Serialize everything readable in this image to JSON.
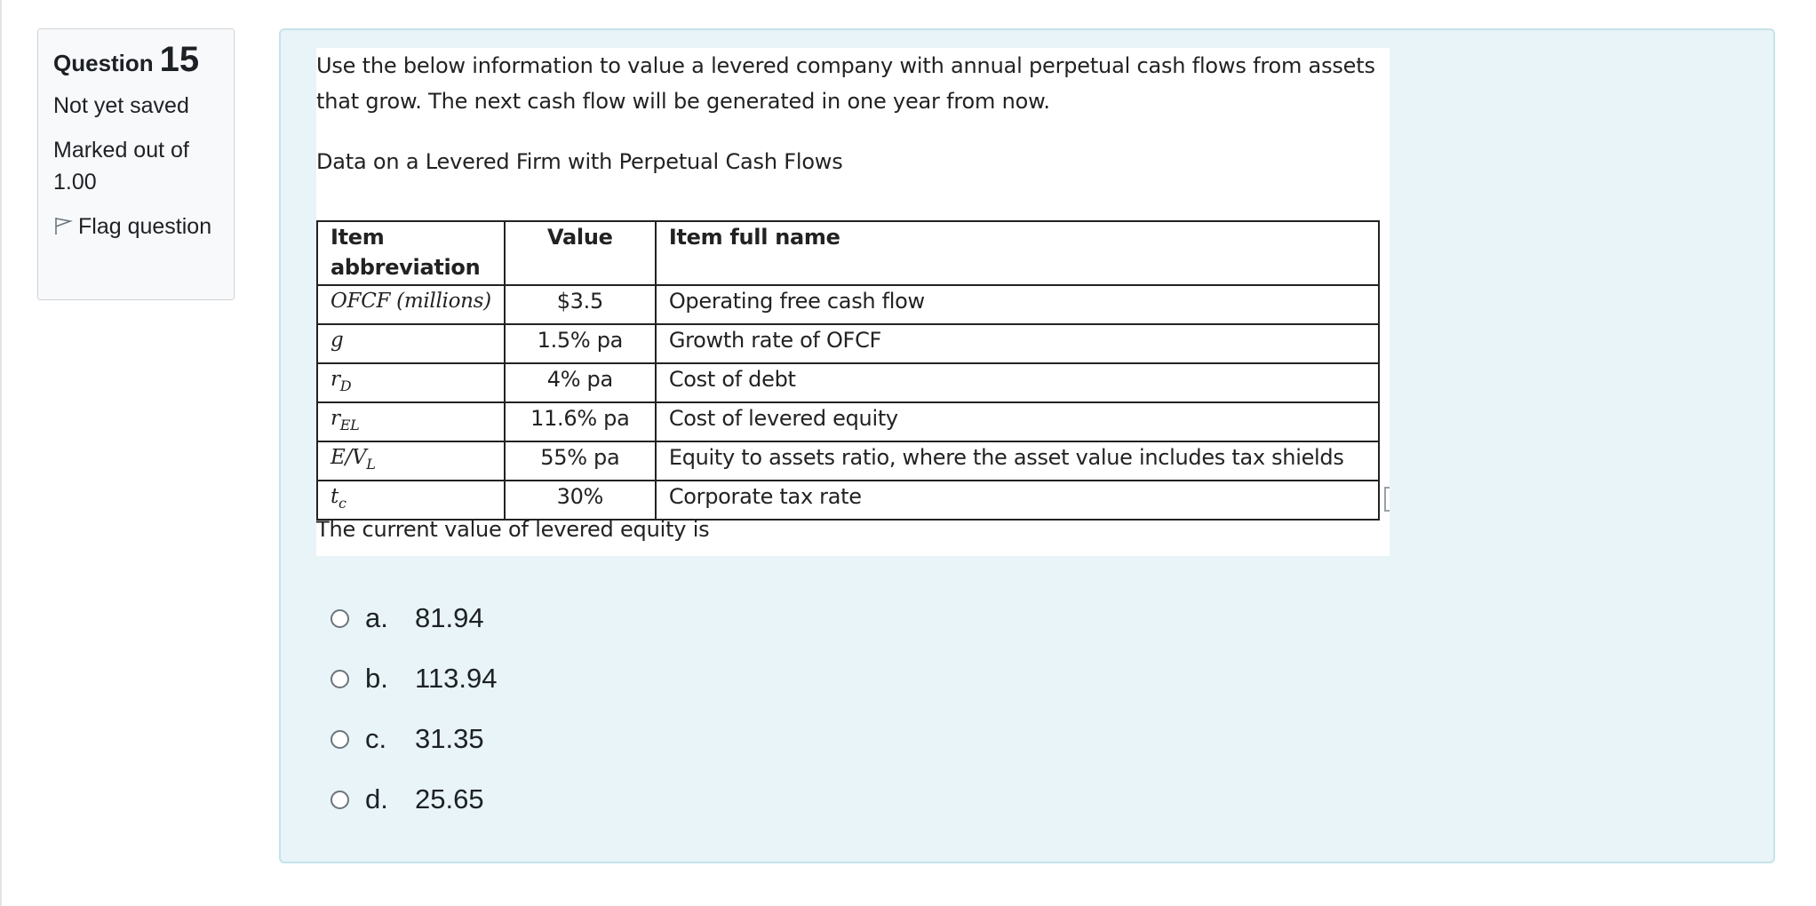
{
  "question_info": {
    "label": "Question",
    "number": "15",
    "status": "Not yet saved",
    "marks": "Marked out of 1.00",
    "flag_label": "Flag question"
  },
  "question": {
    "intro": "Use the below information to value a levered company with annual perpetual cash flows from assets that grow. The next cash flow will be generated in one year from now.",
    "caption": "Data on a Levered Firm with Perpetual Cash Flows",
    "table": {
      "headers": [
        "Item abbreviation",
        "Value",
        "Item full name"
      ],
      "rows": [
        {
          "abbr": "OFCF (millions)",
          "abbr_sub": "",
          "value": "$3.5",
          "name": "Operating free cash flow"
        },
        {
          "abbr": "g",
          "abbr_sub": "",
          "value": "1.5% pa",
          "name": "Growth rate of OFCF"
        },
        {
          "abbr": "r",
          "abbr_sub": "D",
          "value": "4% pa",
          "name": "Cost of debt"
        },
        {
          "abbr": "r",
          "abbr_sub": "EL",
          "value": "11.6% pa",
          "name": "Cost of levered equity"
        },
        {
          "abbr": "E/V",
          "abbr_sub": "L",
          "value": "55% pa",
          "name": "Equity to assets ratio, where the asset value includes tax shields"
        },
        {
          "abbr": "t",
          "abbr_sub": "c",
          "value": "30%",
          "name": "Corporate tax rate"
        }
      ]
    },
    "stem": "The current value of levered equity is"
  },
  "answers": [
    {
      "letter": "a.",
      "value": "81.94"
    },
    {
      "letter": "b.",
      "value": "113.94"
    },
    {
      "letter": "c.",
      "value": "31.35"
    },
    {
      "letter": "d.",
      "value": "25.65"
    }
  ],
  "colors": {
    "content_bg": "#e8f4f7",
    "content_border": "#c6e3ea",
    "info_bg": "#f8f9fa"
  },
  "icons": {
    "flag": "flag-outline-icon",
    "radio": "radio-unchecked-icon"
  }
}
